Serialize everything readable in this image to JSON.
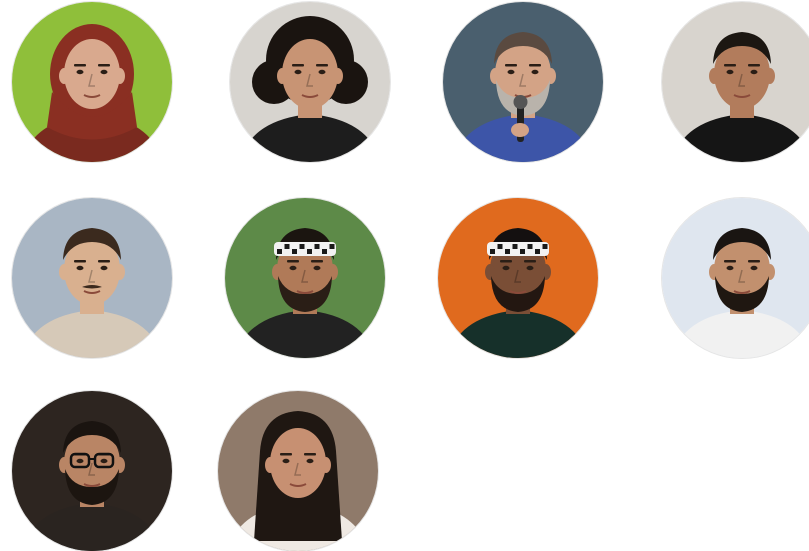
{
  "portraits": [
    {
      "id": "portrait-1",
      "background": "#8fbf3a",
      "skin": "#d9a98e",
      "hair": "#8a2f22",
      "clothing": "#7a2a1f",
      "headscarf": true
    },
    {
      "id": "portrait-2",
      "background": "#d7d4cf",
      "skin": "#c89474",
      "hair": "#1a1410",
      "clothing": "#1d1d1d",
      "curly_hair": true
    },
    {
      "id": "portrait-3",
      "background": "#4a5f6e",
      "skin": "#d3a386",
      "hair": "#5a4a40",
      "clothing": "#3d55a8",
      "beard": "#b9b3ab",
      "microphone": true
    },
    {
      "id": "portrait-4",
      "background": "#d8d4ce",
      "skin": "#b27c5c",
      "hair": "#1c1712",
      "clothing": "#151515"
    },
    {
      "id": "portrait-5",
      "background": "#a9b6c4",
      "skin": "#d9b08f",
      "hair": "#3b2a1e",
      "clothing": "#d6c9b8",
      "moustache": true
    },
    {
      "id": "portrait-6",
      "background": "#5d8a48",
      "skin": "#b07a58",
      "hair": "#1b1510",
      "clothing": "#222222",
      "beard": "#2a1e16",
      "keffiyeh": true
    },
    {
      "id": "portrait-7",
      "background": "#e06a1e",
      "skin": "#7a4e36",
      "hair": "#141010",
      "clothing": "#16302a",
      "beard": "#231711",
      "keffiyeh": true
    },
    {
      "id": "portrait-8",
      "background": "#dfe6ef",
      "skin": "#c2906e",
      "hair": "#1a1512",
      "clothing": "#f1f1f1",
      "beard": "#1f1711"
    },
    {
      "id": "portrait-9",
      "background": "#2d2520",
      "skin": "#b98565",
      "hair": "#1a1410",
      "clothing": "#2a2420",
      "beard": "#1c1510",
      "glasses": true
    },
    {
      "id": "portrait-10",
      "background": "#8f7a6a",
      "skin": "#c79072",
      "hair": "#1f1712",
      "clothing": "#efe9e3",
      "long_hair": true
    }
  ]
}
